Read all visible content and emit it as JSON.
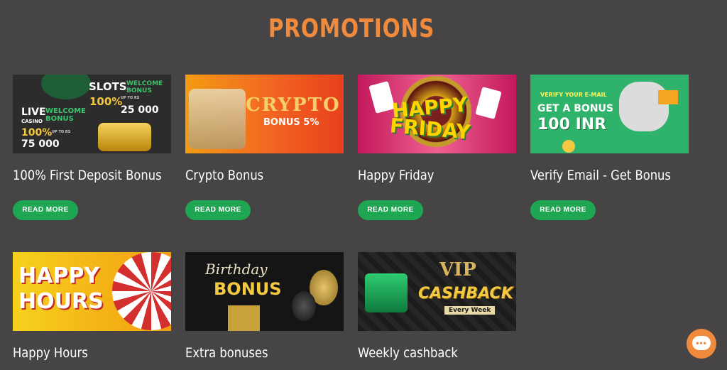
{
  "page": {
    "heading": "PROMOTIONS"
  },
  "promotions": [
    {
      "title": "100% First Deposit Bonus",
      "button": "READ MORE",
      "banner": {
        "slots": "SLOTS",
        "welcome_bonus_1": "WELCOME BONUS",
        "pct_1": "100%",
        "up_to_1": "UP TO RS",
        "amount_1": "25 000",
        "live": "LIVE",
        "casino": "CASINO",
        "welcome_bonus_2": "WELCOME BONUS",
        "pct_2": "100%",
        "up_to_2": "UP TO RS",
        "amount_2": "75 000"
      }
    },
    {
      "title": "Crypto Bonus",
      "button": "READ MORE",
      "banner": {
        "headline": "CRYPTO",
        "sub": "BONUS 5%"
      }
    },
    {
      "title": "Happy Friday",
      "button": "READ MORE",
      "banner": {
        "line1": "HAPPY",
        "line2": "FRIDAY"
      }
    },
    {
      "title": "Verify Email - Get Bonus",
      "button": "READ MORE",
      "banner": {
        "line1": "VERIFY YOUR E-MAIL",
        "line2": "GET A BONUS",
        "line3": "100 INR"
      }
    },
    {
      "title": "Happy Hours",
      "banner": {
        "line1": "HAPPY",
        "line2": "HOURS"
      }
    },
    {
      "title": "Extra bonuses",
      "banner": {
        "line1": "Birthday",
        "line2": "BONUS"
      }
    },
    {
      "title": "Weekly cashback",
      "banner": {
        "line1": "VIP",
        "line2": "CASHBACK",
        "line3": "Every Week"
      }
    }
  ],
  "chat": {
    "icon": "chat-icon",
    "dots": "•••"
  },
  "colors": {
    "background": "#464444",
    "accent": "#f08a3c",
    "button": "#1fa653"
  }
}
